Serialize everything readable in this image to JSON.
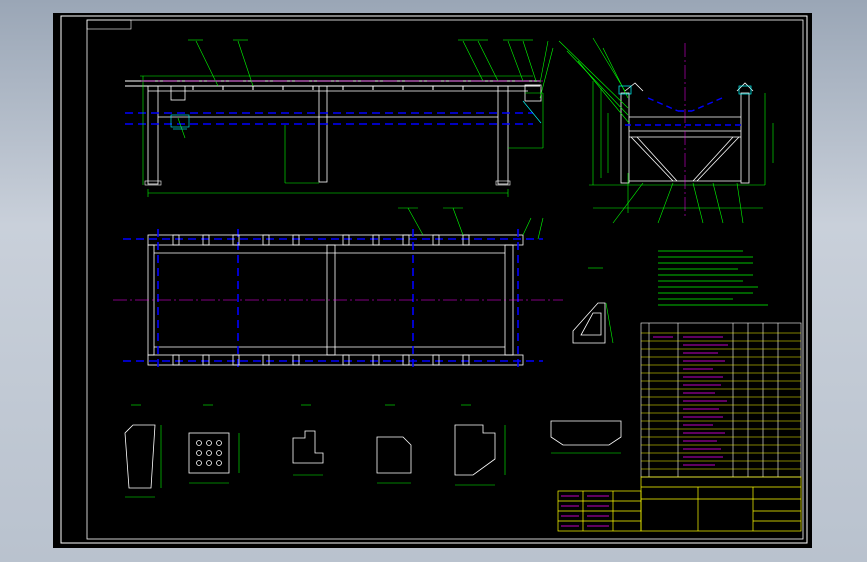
{
  "sheet": {
    "border_color": "#ffff00",
    "background": "#000000",
    "corner_tag": "",
    "tech_title": "",
    "title_block": {
      "line1": "",
      "line2": "",
      "drawing_no": "",
      "scale": ""
    }
  },
  "colors": {
    "structure": "#ffffff",
    "dimension": "#00ff00",
    "hidden": "#0000ff",
    "center": "#ff00ff",
    "titleblock": "#ffff00",
    "highlight": "#00ffff"
  }
}
